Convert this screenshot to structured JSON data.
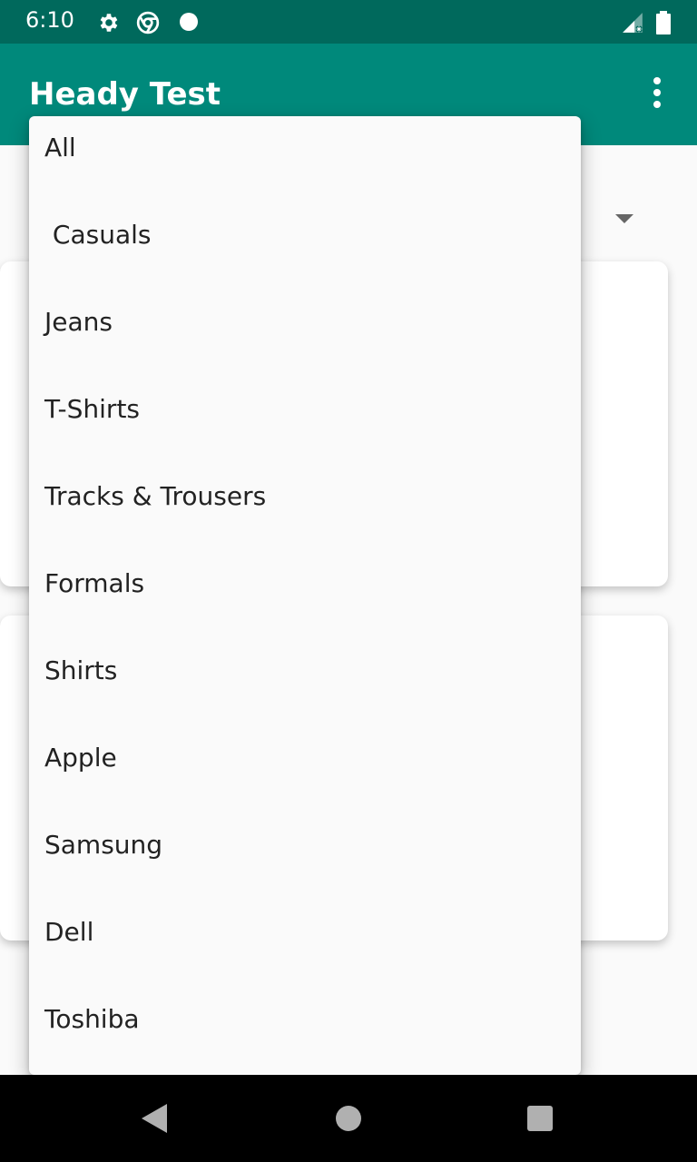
{
  "status_bar": {
    "time": "6:10",
    "icons": [
      "gear-icon",
      "chrome-icon",
      "dot-icon",
      "signal-icon",
      "battery-icon"
    ]
  },
  "app_bar": {
    "title": "Heady Test",
    "menu_icon": "overflow-menu-icon"
  },
  "dropdown": {
    "items": [
      "All",
      " Casuals",
      "Jeans",
      "T-Shirts",
      "Tracks & Trousers",
      "Formals",
      "Shirts",
      "Apple",
      "Samsung",
      "Dell",
      "Toshiba"
    ]
  },
  "nav_bar": {
    "icons": [
      "back-icon",
      "home-icon",
      "recents-icon"
    ]
  },
  "colors": {
    "status_bar": "#00695c",
    "app_bar": "#00897b",
    "background": "#fafafa"
  }
}
